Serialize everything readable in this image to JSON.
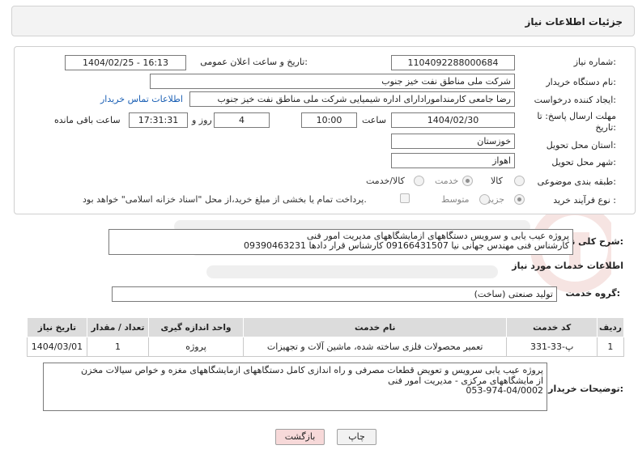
{
  "header": {
    "title": "جزئیات اطلاعات نیاز"
  },
  "form": {
    "need_number_label": "شماره نیاز:",
    "need_number": "1104092288000684",
    "announce_label": "تاریخ و ساعت اعلان عمومی:",
    "announce_value": "1404/02/25 - 16:13",
    "buyer_org_label": "نام دستگاه خریدار:",
    "buyer_org": "شرکت ملی مناطق نفت خیز جنوب",
    "requester_label": "ایجاد کننده درخواست:",
    "requester": "رضا جامعی کارمندامورادارای اداره شیمیایی شرکت ملی مناطق نفت خیز جنوب",
    "contact_link": "اطلاعات تماس خریدار",
    "deadline_label_1": "مهلت ارسال پاسخ: تا",
    "deadline_label_2": "تاریخ:",
    "deadline_date": "1404/02/30",
    "time_label": "ساعت",
    "deadline_time": "10:00",
    "days_value": "4",
    "days_label": "روز و",
    "remaining_time": "17:31:31",
    "remaining_label": "ساعت باقی مانده",
    "province_label": "استان محل تحویل:",
    "province": "خوزستان",
    "city_label": "شهر محل تحویل:",
    "city": "اهواز",
    "category_label": "طبقه بندی موضوعی:",
    "category_options": [
      "کالا",
      "خدمت",
      "کالا/خدمت"
    ],
    "category_selected": "خدمت",
    "process_label": "نوع فرآیند خرید :",
    "process_options": [
      "جزیی",
      "متوسط"
    ],
    "process_selected": "جزیی",
    "payment_note": "پرداخت تمام یا بخشی از مبلغ خرید،از محل \"اسناد خزانه اسلامی\" خواهد بود."
  },
  "summary": {
    "label": "شرح کلی نیاز:",
    "line1": "پروژه عیب یابی و سرویس  دستگاههای ازمایشگاههای مدیریت امور فنی",
    "line2": "کارشناس فنی مهندس جهانی نیا 09166431507 کارشناس قرار دادها 09390463231"
  },
  "services": {
    "section_title": "اطلاعات خدمات مورد نیاز",
    "group_label": "گروه خدمت:",
    "group_value": "تولید صنعتی (ساخت)",
    "columns": [
      "ردیف",
      "کد خدمت",
      "نام خدمت",
      "واحد اندازه گیری",
      "تعداد / مقدار",
      "تاریخ نیاز"
    ],
    "rows": [
      [
        "1",
        "پ-33-331",
        "تعمیر محصولات فلزی ساخته شده، ماشین آلات و تجهیزات",
        "پروژه",
        "1",
        "1404/03/01"
      ]
    ]
  },
  "buyer_notes": {
    "label": "توضیحات خریدار:",
    "line1": "پروژه عیب یابی سرویس و تعویض قطعات مصرفی و راه اندازی کامل دستگاههای ازمایشگاههای مغزه و خواص سیالات مخزن",
    "line2": "از مایشگاههای مرکزی - مدیریت امور فنی",
    "line3": "053-974-04/0002"
  },
  "buttons": {
    "print": "چاپ",
    "back": "بازگشت"
  }
}
